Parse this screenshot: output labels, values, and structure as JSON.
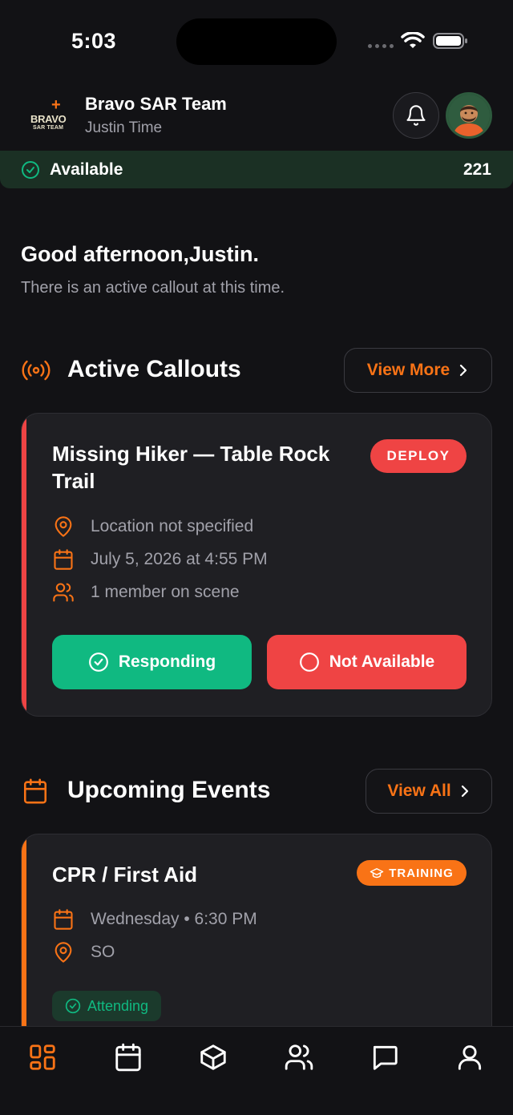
{
  "status_bar": {
    "time": "5:03"
  },
  "header": {
    "logo_mark": "+",
    "logo_text": "BRAVO",
    "logo_subtext": "SAR TEAM",
    "team_name": "Bravo SAR Team",
    "user_name": "Justin Time"
  },
  "availability": {
    "label": "Available",
    "count": "221",
    "color": "#1b3024"
  },
  "greeting": {
    "title": "Good afternoon,Justin.",
    "subtitle": "There is an active callout at this time."
  },
  "active_callouts": {
    "title": "Active Callouts",
    "view_more_label": "View More",
    "card": {
      "title_line1": "Missing Hiker — Table Rock",
      "title_line2": "Trail",
      "badge": "DEPLOY",
      "location": "Location not specified",
      "datetime": "July 5, 2026 at 4:55 PM",
      "members": "1 member on scene",
      "responding_label": "Responding",
      "not_available_label": "Not Available",
      "accent_color": "#ef4444"
    }
  },
  "upcoming_events": {
    "title": "Upcoming Events",
    "view_all_label": "View All",
    "card": {
      "title": "CPR / First Aid",
      "badge": "TRAINING",
      "datetime": "Wednesday • 6:30 PM",
      "location": "SO",
      "status": "Attending",
      "accent_color": "#f97316"
    }
  },
  "tab_bar": {
    "active_color": "#f97316",
    "tabs": [
      "dashboard-icon",
      "calendar-icon",
      "package-icon",
      "users-icon",
      "messages-icon",
      "profile-icon"
    ]
  }
}
